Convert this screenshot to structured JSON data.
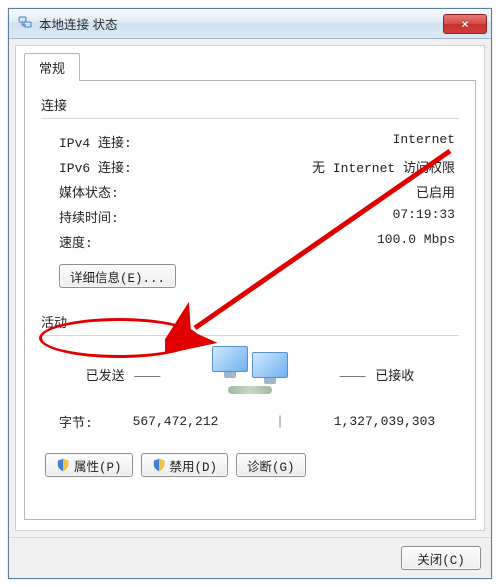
{
  "window": {
    "title": "本地连接 状态",
    "close_label": "×"
  },
  "tab": {
    "general": "常规"
  },
  "connection": {
    "heading": "连接",
    "rows": {
      "ipv4_label": "IPv4 连接:",
      "ipv4_value": "Internet",
      "ipv6_label": "IPv6 连接:",
      "ipv6_value": "无 Internet 访问权限",
      "media_label": "媒体状态:",
      "media_value": "已启用",
      "duration_label": "持续时间:",
      "duration_value": "07:19:33",
      "speed_label": "速度:",
      "speed_value": "100.0 Mbps"
    },
    "details_button": "详细信息(E)..."
  },
  "activity": {
    "heading": "活动",
    "sent_label": "已发送",
    "received_label": "已接收",
    "separator": "——",
    "bytes_label": "字节:",
    "bytes_sent": "567,472,212",
    "bytes_received": "1,327,039,303",
    "divider": "|"
  },
  "buttons": {
    "properties": "属性(P)",
    "disable": "禁用(D)",
    "diagnose": "诊断(G)",
    "close": "关闭(C)"
  },
  "colors": {
    "annotation": "#e00000"
  }
}
